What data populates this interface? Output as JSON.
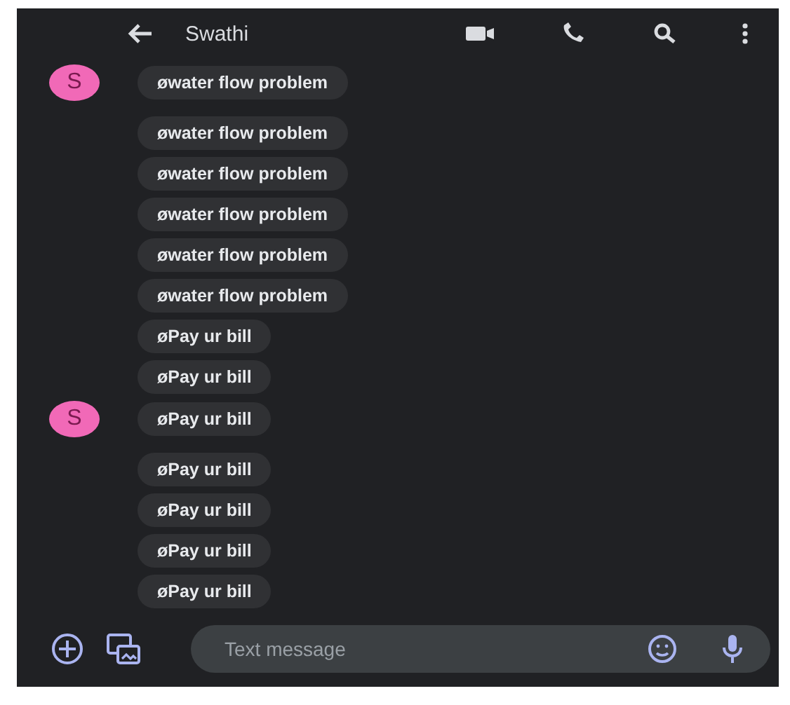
{
  "header": {
    "title": "Swathi"
  },
  "groups": [
    {
      "avatar": "S",
      "messages": [
        "øwater flow problem"
      ]
    },
    {
      "avatar": "S",
      "messages": [
        "øwater flow problem",
        "øwater flow problem",
        "øwater flow problem",
        "øwater flow problem",
        "øwater flow problem",
        "øPay ur bill",
        "øPay ur bill",
        "øPay ur bill"
      ]
    },
    {
      "messages": [
        "øPay ur bill",
        "øPay ur bill",
        "øPay ur bill",
        "øPay ur bill"
      ]
    }
  ],
  "composer": {
    "placeholder": "Text message"
  }
}
